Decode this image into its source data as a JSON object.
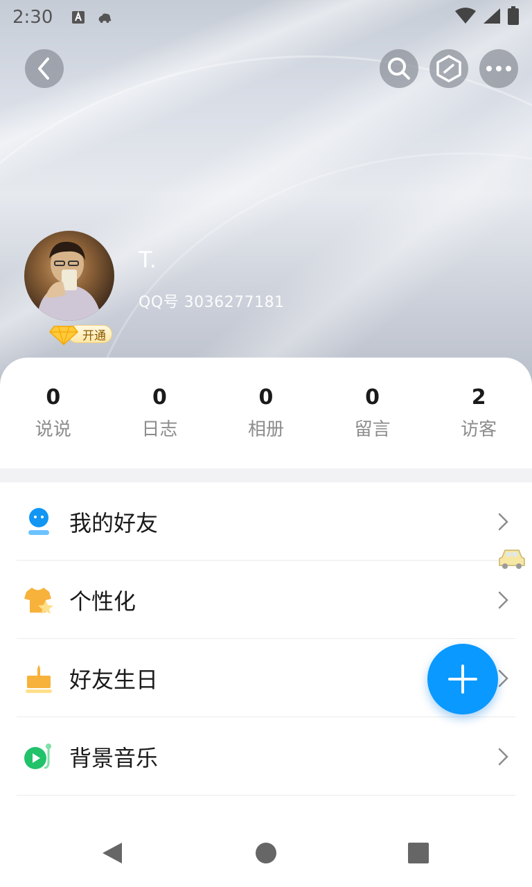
{
  "status_bar": {
    "time": "2:30",
    "left_icons": [
      "text-a-icon",
      "cloud-car-icon"
    ],
    "right_icons": [
      "wifi-icon",
      "signal-icon",
      "battery-icon"
    ]
  },
  "top_nav": {
    "back_icon": "back-arrow-icon",
    "search_icon": "search-icon",
    "hexagon_icon": "hexagon-edit-icon",
    "more_icon": "more-dots-icon"
  },
  "profile": {
    "name": "T.",
    "qq_number": "QQ号 3036277181",
    "vip_label": "开通"
  },
  "stats": [
    {
      "value": "0",
      "label": "说说"
    },
    {
      "value": "0",
      "label": "日志"
    },
    {
      "value": "0",
      "label": "相册"
    },
    {
      "value": "0",
      "label": "留言"
    },
    {
      "value": "2",
      "label": "访客"
    }
  ],
  "menu": [
    {
      "label": "我的好友",
      "icon": "friends-icon"
    },
    {
      "label": "个性化",
      "icon": "personalize-shirt-icon"
    },
    {
      "label": "好友生日",
      "icon": "birthday-cake-icon"
    },
    {
      "label": "背景音乐",
      "icon": "music-play-icon"
    }
  ],
  "colors": {
    "accent": "#0a99ff",
    "friends_icon": "#1296f3",
    "personalize_icon": "#f7b23b",
    "birthday_icon": "#f7b23b",
    "music_icon": "#21c26a"
  },
  "fab": {
    "icon": "plus-icon"
  },
  "system_nav": {
    "back": "nav-back-icon",
    "home": "nav-home-icon",
    "recents": "nav-recents-icon"
  }
}
